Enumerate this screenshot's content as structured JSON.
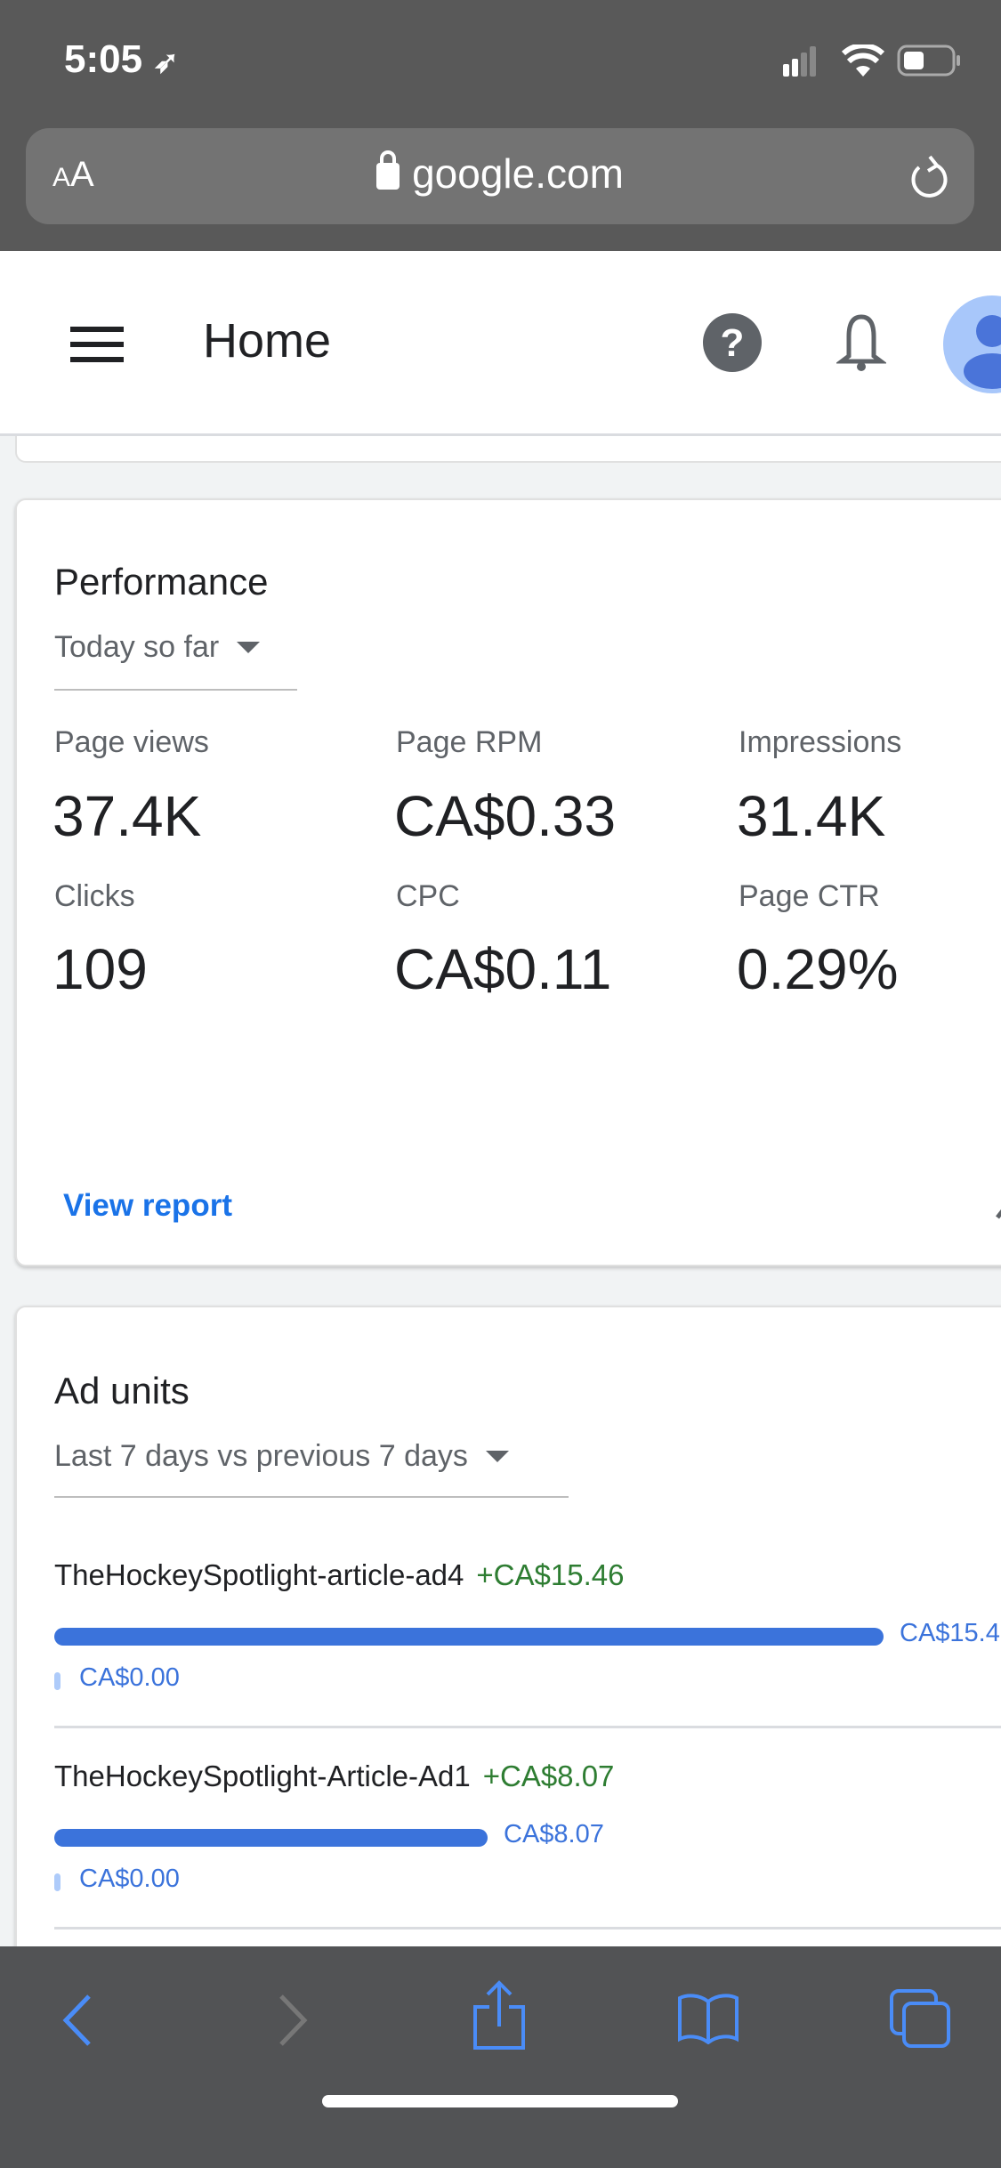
{
  "status_bar": {
    "time": "5:05"
  },
  "browser": {
    "text_size_label_small": "A",
    "text_size_label_large": "A",
    "url": "google.com"
  },
  "header": {
    "title": "Home"
  },
  "performance": {
    "title": "Performance",
    "range": "Today so far",
    "metrics": [
      {
        "label": "Page views",
        "value": "37.4K"
      },
      {
        "label": "Page RPM",
        "value": "CA$0.33"
      },
      {
        "label": "Impressions",
        "value": "31.4K"
      },
      {
        "label": "Clicks",
        "value": "109"
      },
      {
        "label": "CPC",
        "value": "CA$0.11"
      },
      {
        "label": "Page CTR",
        "value": "0.29%"
      }
    ],
    "view_report": "View report"
  },
  "ad_units": {
    "title": "Ad units",
    "range": "Last 7 days vs previous 7 days",
    "items": [
      {
        "name": "TheHockeySpotlight-article-ad4",
        "change": "+CA$15.46",
        "current": "CA$15.46",
        "current_label": "CA$15.4",
        "previous": "CA$0.00",
        "fraction": 1.0
      },
      {
        "name": "TheHockeySpotlight-Article-Ad1",
        "change": "+CA$8.07",
        "current": "CA$8.07",
        "current_label": "CA$8.07",
        "previous": "CA$0.00",
        "fraction": 0.522
      }
    ]
  },
  "colors": {
    "accent": "#1a73e8",
    "bar": "#3b73db",
    "positive": "#2e7d32"
  }
}
